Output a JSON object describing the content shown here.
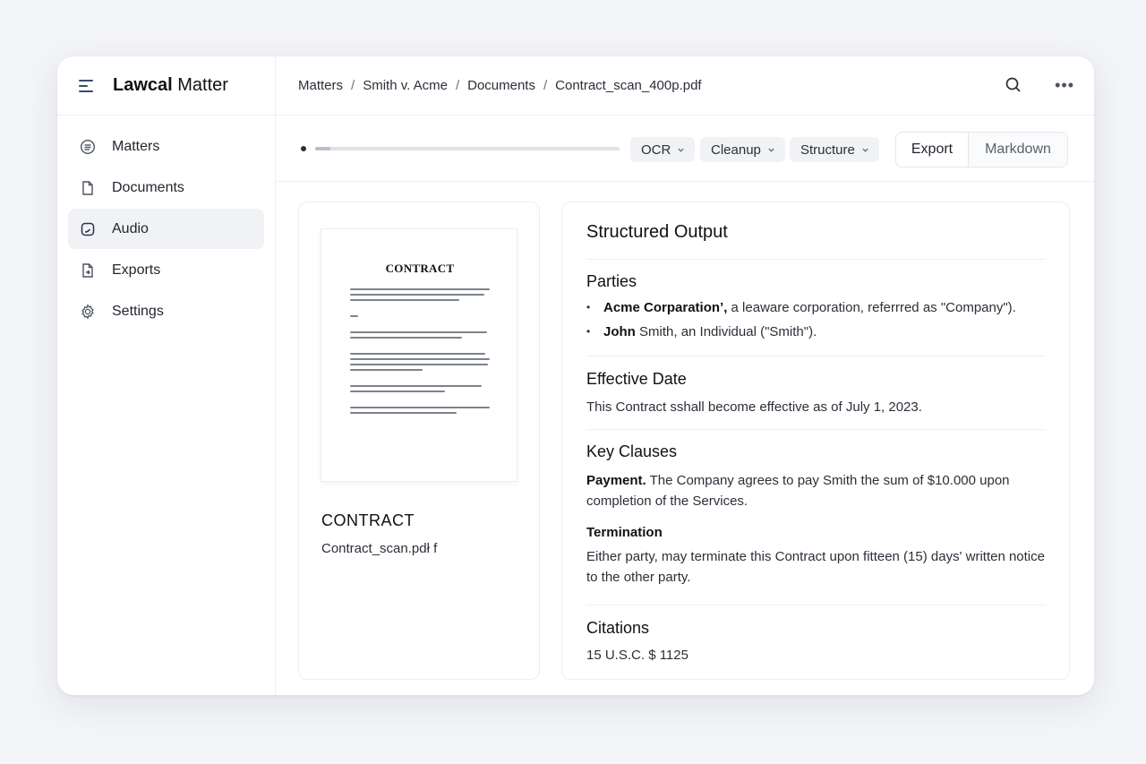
{
  "brand": {
    "strong": "Lawcal",
    "light": "Matter"
  },
  "sidebar": {
    "items": [
      {
        "label": "Matters",
        "icon": "list-circle-icon",
        "active": false
      },
      {
        "label": "Documents",
        "icon": "document-icon",
        "active": false
      },
      {
        "label": "Audio",
        "icon": "audio-icon",
        "active": true
      },
      {
        "label": "Exports",
        "icon": "export-file-icon",
        "active": false
      },
      {
        "label": "Settings",
        "icon": "gear-icon",
        "active": false
      }
    ]
  },
  "breadcrumb": [
    "Matters",
    "Smith v. Acme",
    "Documents",
    "Contract_scan_400p.pdf"
  ],
  "toolbar": {
    "progress": 0.05,
    "chips": [
      "OCR",
      "Cleanup",
      "Structure"
    ],
    "export_label": "Export",
    "markdown_label": "Markdown"
  },
  "preview": {
    "page_heading": "CONTRACT",
    "title": "CONTRACT",
    "filename": "Contract_scan.pdł f"
  },
  "output": {
    "title": "Structured Output",
    "parties": {
      "heading": "Parties",
      "items": [
        {
          "name": "Acme Corparation’,",
          "rest": " a leaware corporation, referrred as \"Company\")."
        },
        {
          "name": "John",
          "rest": " Smith, an Individual (\"Smith\")."
        }
      ]
    },
    "effective": {
      "heading": "Effective Date",
      "text": "This Contract sshall become effective as of July 1, 2023."
    },
    "clauses": {
      "heading": "Key Clauses",
      "payment_label": "Payment.",
      "payment_text": " The Company agrees to pay Smith the sum of $10.000 upon completion of the Services.",
      "termination_label": "Termination",
      "termination_text": "Either party, may terminate this Contract  upon fitteen (15) days' written notice to the other party."
    },
    "citations": {
      "heading": "Citations",
      "text": "15 U.S.C. $ 1125"
    }
  }
}
